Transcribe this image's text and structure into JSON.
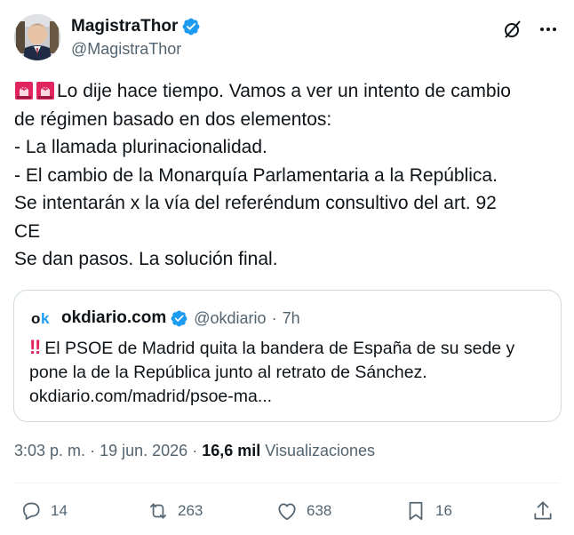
{
  "author": {
    "name": "MagistraThor",
    "handle": "@MagistraThor"
  },
  "header_icons": [
    "grok-icon",
    "more-icon"
  ],
  "body": {
    "line1": "Lo dije hace tiempo. Vamos a ver un intento de cambio",
    "line2": "de régimen basado en dos elementos:",
    "line3": "- La llamada plurinacionalidad.",
    "line4": "- El cambio de la Monarquía Parlamentaria a la República.",
    "line5": "Se intentarán x la vía del referéndum consultivo del art. 92",
    "line6": "CE",
    "line7": "Se dan pasos. La solución final."
  },
  "quote": {
    "name": "okdiario.com",
    "handle": "@okdiario",
    "separator": "·",
    "time": "7h",
    "bang": "‼",
    "line1": "El PSOE de Madrid quita la bandera de España de su sede y",
    "line2": "pone la de la República junto al retrato de Sánchez.",
    "line3": "okdiario.com/madrid/psoe-ma..."
  },
  "stats": {
    "time": "3:03 p. m.",
    "sep1": "·",
    "date": "19 jun. 2026",
    "sep2": "·",
    "views_count": "16,6 mil",
    "views_label": "Visualizaciones"
  },
  "actions": {
    "replies": "14",
    "reposts": "263",
    "likes": "638",
    "bookmarks": "16"
  },
  "colors": {
    "verified": "#1d9bf0",
    "text": "#0f1419",
    "secondary": "#536471",
    "border": "#cfd9de",
    "siren": "#e0245e"
  }
}
